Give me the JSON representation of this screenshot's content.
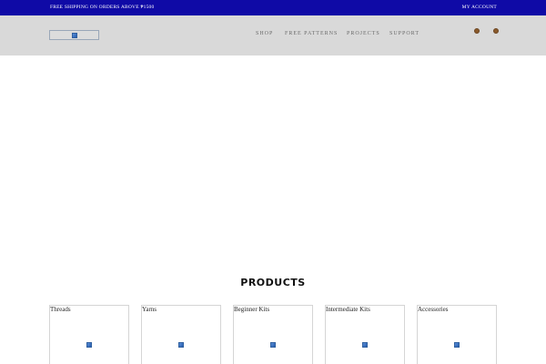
{
  "topbar": {
    "shipping_text": "FREE SHIPPING ON ORDERS ABOVE ₱1500",
    "account_label": "MY ACCOUNT"
  },
  "header": {
    "logo_icon": "broken-image-icon",
    "nav": [
      "SHOP",
      "FREE PATTERNS",
      "PROJECTS",
      "SUPPORT"
    ],
    "icons": [
      "account-icon",
      "cart-icon"
    ]
  },
  "products": {
    "title": "PRODUCTS",
    "categories": [
      {
        "label": "Threads",
        "icon": "broken-image-icon"
      },
      {
        "label": "Yarns",
        "icon": "broken-image-icon"
      },
      {
        "label": "Beginner Kits",
        "icon": "broken-image-icon"
      },
      {
        "label": "Intermediate Kits",
        "icon": "broken-image-icon"
      },
      {
        "label": "Accessories",
        "icon": "broken-image-icon"
      }
    ]
  },
  "colors": {
    "topbar_bg": "#0f0aa6",
    "header_bg": "#d9d9d9",
    "nav_text": "#6b6b6b",
    "icon_fill": "#8a5a2b"
  }
}
